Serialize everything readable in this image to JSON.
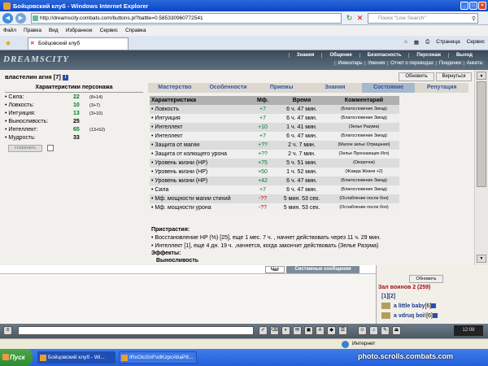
{
  "browser": {
    "title": "Бойцовский клуб - Windows Internet Explorer",
    "url": "http://dreamscity.combats.com/buttons.pl?battle=0.585330960772541",
    "search_placeholder": "Поиск \"Live Search\"",
    "menu": [
      "Файл",
      "Правка",
      "Вид",
      "Избранное",
      "Сервис",
      "Справка"
    ],
    "tab_label": "Бойцовский клуб",
    "toolbar": [
      "Страница",
      "Сервис"
    ],
    "status_zone": "Интернет"
  },
  "game": {
    "logo": "DREAMSCITY",
    "nav_top": [
      "Знания",
      "Общение",
      "Безопасность",
      "Персонаж",
      "Выход"
    ],
    "nav_sub": [
      "Инвентарь",
      "Умения",
      "Отчет о переводах",
      "Поединки",
      "Анкета"
    ]
  },
  "character": {
    "name": "властелин агня",
    "level": "[7]",
    "refresh_label": "Обновить",
    "back_label": "Вернуться",
    "stats_title": "Характеристики персонажа",
    "stats": [
      {
        "name": "Сила:",
        "value": "22",
        "bonus": "(8+14)"
      },
      {
        "name": "Ловкость:",
        "value": "10",
        "bonus": "(3+7)"
      },
      {
        "name": "Интуиция:",
        "value": "13",
        "bonus": "(3+10)"
      },
      {
        "name": "Выносливость:",
        "value": "25",
        "bonus": ""
      },
      {
        "name": "Интеллект:",
        "value": "65",
        "bonus": "(13+52)"
      },
      {
        "name": "Мудрость:",
        "value": "33",
        "bonus": ""
      }
    ],
    "save_label": "сохранить"
  },
  "tabs": [
    "Мастерство",
    "Особенности",
    "Приемы",
    "Знания",
    "Состояние",
    "Репутация"
  ],
  "active_tab": "Состояние",
  "effects_table": {
    "headers": [
      "Характеристика",
      "Мф.",
      "Время",
      "Комментарий"
    ],
    "rows": [
      {
        "name": "Ловкость",
        "mf": "+7",
        "time": "6 ч. 47 мин.",
        "comment": "(Благословение Звезд)"
      },
      {
        "name": "Интуиция",
        "mf": "+7",
        "time": "6 ч. 47 мин.",
        "comment": "(Благословение Звезд)"
      },
      {
        "name": "Интеллект",
        "mf": "+10",
        "time": "1 ч. 41 мин.",
        "comment": "(Зелье Разума)"
      },
      {
        "name": "Интеллект",
        "mf": "+7",
        "time": "6 ч. 47 мин.",
        "comment": "(Благословение Звезд)"
      },
      {
        "name": "Защита от магии",
        "mf": "+??",
        "time": "2 ч. 7 мин.",
        "comment": "(Малое зелье Отрицания)"
      },
      {
        "name": "Защита от колющего урона",
        "mf": "+??",
        "time": "2 ч. 7 мин.",
        "comment": "(Зелье Пронзающих Игл)"
      },
      {
        "name": "Уровень жизни (HP)",
        "mf": "+75",
        "time": "5 ч. 51 мин.",
        "comment": "(Окорочок)"
      },
      {
        "name": "Уровень жизни (HP)",
        "mf": "+50",
        "time": "1 ч. 52 мин.",
        "comment": "(Жажда Жизни +2)"
      },
      {
        "name": "Уровень жизни (HP)",
        "mf": "+42",
        "time": "6 ч. 47 мин.",
        "comment": "(Благословение Звезд)"
      },
      {
        "name": "Сила",
        "mf": "+7",
        "time": "6 ч. 47 мин.",
        "comment": "(Благословение Звезд)"
      },
      {
        "name": "Мф. мощности магии стихий",
        "mf": "-??",
        "time": "5 мин. 53 сек.",
        "comment": "(Ослабление после боя)"
      },
      {
        "name": "Мф. мощности урона",
        "mf": "-??",
        "time": "5 мин. 53 сек.",
        "comment": "(Ослабление после боя)"
      }
    ]
  },
  "extras": {
    "title": "Пристрастия:",
    "line1": "• Восстановление HP (%) [25], еще 1 мес. 7 ч. , начнет действовать через 11 ч. 29 мин.",
    "line2": "• Интеллект [1], еще 4 дн. 19 ч. ,начнется, когда закончит действовать (Зелье Разума)",
    "effects_title": "Эффекты:",
    "effect1": "Выносливость"
  },
  "chat": {
    "tab_chat": "Чат",
    "tab_system": "Системные сообщения"
  },
  "room": {
    "refresh_label": "Обновить",
    "title": "Зал воинов 2 (259)",
    "pages": "[1][2]",
    "players": [
      {
        "name": "a little baby",
        "level": "[6]"
      },
      {
        "name": "a vdruq boi!",
        "level": "[6]"
      }
    ]
  },
  "taskbar": {
    "start": "Пуск",
    "tasks": [
      "Бойцовский клуб - Wi...",
      "IRxOicGnFvdKzpcAhaP8..."
    ],
    "clock": "12:08"
  },
  "watermark": "photo.scrolls.combats.com"
}
